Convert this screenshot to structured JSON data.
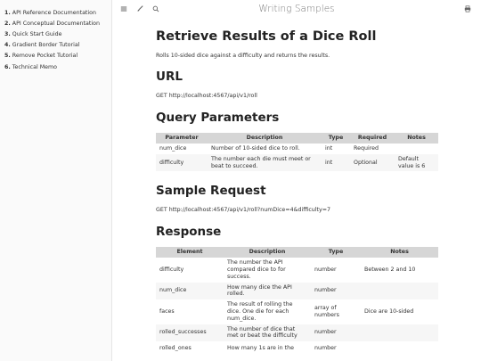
{
  "sidebar": {
    "items": [
      {
        "num": "1.",
        "label": "API Reference Documentation"
      },
      {
        "num": "2.",
        "label": "API Conceptual Documentation"
      },
      {
        "num": "3.",
        "label": "Quick Start Guide"
      },
      {
        "num": "4.",
        "label": "Gradient Border Tutorial"
      },
      {
        "num": "5.",
        "label": "Remove Pocket Tutorial"
      },
      {
        "num": "6.",
        "label": "Technical Memo"
      }
    ]
  },
  "header": {
    "title": "Writing Samples",
    "icons": [
      "menu-icon",
      "brush-icon",
      "search-icon",
      "print-icon"
    ]
  },
  "page": {
    "title": "Retrieve Results of a Dice Roll",
    "description": "Rolls 10-sided dice against a difficulty and returns the results.",
    "url_heading": "URL",
    "url": "GET http://localhost:4567/api/v1/roll",
    "query_heading": "Query Parameters",
    "sample_heading": "Sample Request",
    "sample_request": "GET http://localhost:4567/api/v1/roll?numDice=4&difficulty=7",
    "response_heading": "Response"
  },
  "query_table": {
    "headers": [
      "Parameter",
      "Description",
      "Type",
      "Required",
      "Notes"
    ],
    "rows": [
      [
        "num_dice",
        "Number of 10-sided dice to roll.",
        "int",
        "Required",
        ""
      ],
      [
        "difficulty",
        "The number each die must meet or beat to succeed.",
        "int",
        "Optional",
        "Default value is 6"
      ]
    ]
  },
  "response_table": {
    "headers": [
      "Element",
      "Description",
      "Type",
      "Notes"
    ],
    "rows": [
      [
        "difficulty",
        "The number the API compared dice to for success.",
        "number",
        "Between 2 and 10"
      ],
      [
        "num_dice",
        "How many dice the API rolled.",
        "number",
        ""
      ],
      [
        "faces",
        "The result of rolling the dice. One die for each num_dice.",
        "array of numbers",
        "Dice are 10-sided"
      ],
      [
        "rolled_successes",
        "The number of dice that met or beat the difficulty",
        "number",
        ""
      ],
      [
        "rolled_ones",
        "How many 1s are in the",
        "number",
        ""
      ]
    ]
  }
}
